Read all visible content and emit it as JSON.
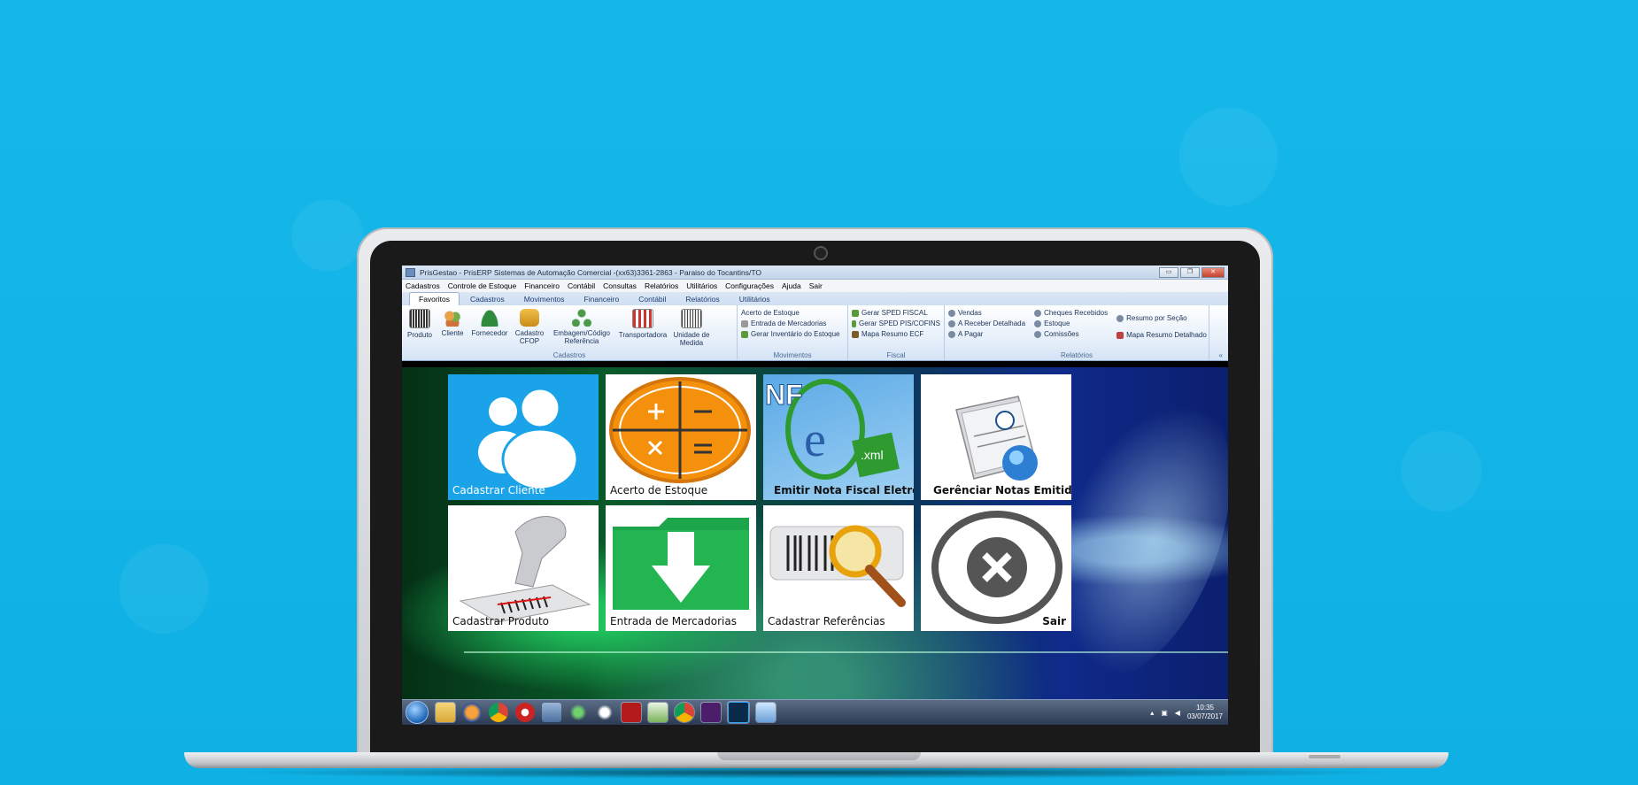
{
  "window": {
    "title": "PrisGestao - PrisERP  Sistemas de Automação Comercial -(xx63)3361-2863 - Paraiso do Tocantins/TO",
    "controls": [
      "▭",
      "❐",
      "✕"
    ]
  },
  "menu": [
    "Cadastros",
    "Controle de Estoque",
    "Financeiro",
    "Contábil",
    "Consultas",
    "Relatórios",
    "Utilitários",
    "Configurações",
    "Ajuda",
    "Sair"
  ],
  "tabs": [
    {
      "label": "Favoritos",
      "active": true
    },
    {
      "label": "Cadastros",
      "active": false
    },
    {
      "label": "Movimentos",
      "active": false
    },
    {
      "label": "Financeiro",
      "active": false
    },
    {
      "label": "Contábil",
      "active": false
    },
    {
      "label": "Relatórios",
      "active": false
    },
    {
      "label": "Utilitários",
      "active": false
    }
  ],
  "ribbon": {
    "cadastros": {
      "label": "Cadastros",
      "buttons": [
        {
          "label": "Produto",
          "icon": "barcode-icon"
        },
        {
          "label": "Cliente",
          "icon": "users-icon"
        },
        {
          "label": "Fornecedor",
          "icon": "person-icon"
        },
        {
          "label": "Cadastro CFOP",
          "icon": "coins-icon"
        },
        {
          "label": "Embagem/Código Referência",
          "icon": "network-icon"
        },
        {
          "label": "Transportadora",
          "icon": "store-icon"
        },
        {
          "label": "Unidade de Medida",
          "icon": "ruler-icon"
        }
      ]
    },
    "movimentos": {
      "label": "Movimentos",
      "items": [
        "Acerto de Estoque",
        "Entrada de Mercadorias",
        "Gerar Inventário do Estoque"
      ]
    },
    "fiscal": {
      "label": "Fiscal",
      "items": [
        "Gerar SPED FISCAL",
        "Gerar SPED PIS/COFINS",
        "Mapa Resumo ECF"
      ]
    },
    "relatorios": {
      "label": "Relatórios",
      "col1": [
        "Vendas",
        "A Receber Detalhada",
        "A Pagar"
      ],
      "col2": [
        "Cheques Recebidos",
        "Estoque",
        "Comissões"
      ],
      "col3": [
        "Resumo por Seção",
        "Mapa Resumo Detalhado"
      ]
    },
    "collapse": "«"
  },
  "tiles": [
    {
      "label": "Cadastrar Cliente",
      "icon": "users-icon"
    },
    {
      "label": "Acerto de Estoque",
      "icon": "calculator-icon"
    },
    {
      "label": "Emitir Nota Fiscal Eletrônica",
      "icon": "nfe-icon",
      "logo_text": "NF",
      "xml_text": ".xml"
    },
    {
      "label": "Gerênciar Notas Emitidas",
      "icon": "documents-icon"
    },
    {
      "label": "Cadastrar Produto",
      "icon": "barcode-scanner-icon"
    },
    {
      "label": "Entrada de Mercadorias",
      "icon": "folder-download-icon"
    },
    {
      "label": "Cadastrar Referências",
      "icon": "barcode-search-icon"
    },
    {
      "label": "Sair",
      "icon": "close-icon"
    }
  ],
  "taskbar": {
    "icons": [
      "folder-icon",
      "firefox-icon",
      "chrome-icon",
      "app-red-icon",
      "database-icon",
      "recycle-icon",
      "paw-icon",
      "pdf-icon",
      "spreadsheet-icon",
      "chrome-icon",
      "ps-purple-icon",
      "photoshop-icon",
      "monitor-icon"
    ],
    "tray": [
      "▴",
      "▣",
      "◀"
    ],
    "time": "10:35",
    "date": "03/07/2017"
  }
}
